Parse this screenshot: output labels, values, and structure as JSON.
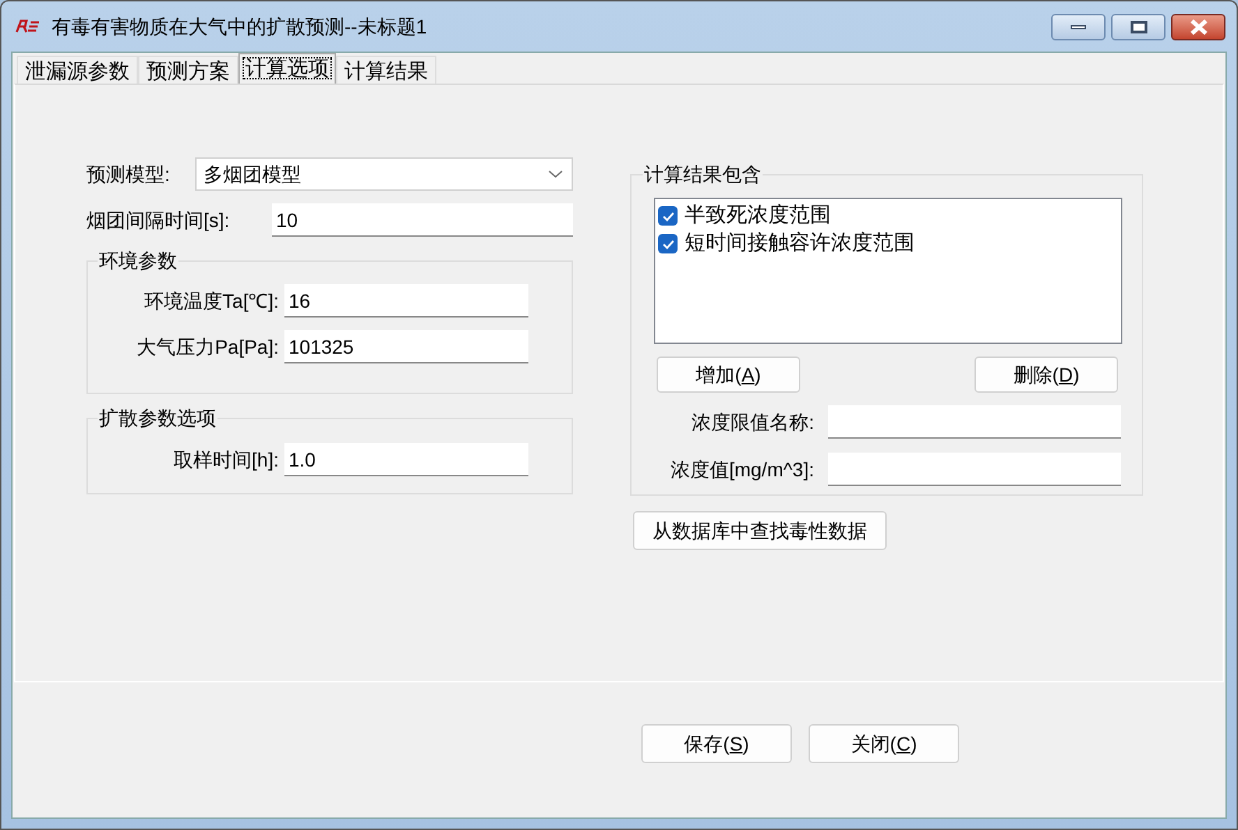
{
  "window": {
    "title": "有毒有害物质在大气中的扩散预测--未标题1"
  },
  "tabs": [
    {
      "label": "泄漏源参数",
      "selected": false
    },
    {
      "label": "预测方案",
      "selected": false
    },
    {
      "label": "计算选项",
      "selected": true
    },
    {
      "label": "计算结果",
      "selected": false
    }
  ],
  "model": {
    "label": "预测模型:",
    "value": "多烟团模型"
  },
  "puff_interval": {
    "label": "烟团间隔时间[s]:",
    "value": "10"
  },
  "environment": {
    "title": "环境参数",
    "fields": [
      {
        "label": "环境温度Ta[℃]:",
        "value": "16"
      },
      {
        "label": "大气压力Pa[Pa]:",
        "value": "101325"
      }
    ]
  },
  "diffusion": {
    "title": "扩散参数选项",
    "fields": [
      {
        "label": "取样时间[h]:",
        "value": "1.0"
      }
    ]
  },
  "results": {
    "title": "计算结果包含",
    "items": [
      {
        "label": "半致死浓度范围",
        "checked": true
      },
      {
        "label": "短时间接触容许浓度范围",
        "checked": true
      }
    ],
    "buttons": [
      {
        "before": "增加(",
        "key": "A",
        "after": ")"
      },
      {
        "before": "删除(",
        "key": "D",
        "after": ")"
      }
    ],
    "fields": [
      {
        "label": "浓度限值名称:"
      },
      {
        "label": "浓度值[mg/m^3]:"
      }
    ]
  },
  "lookup_button": {
    "label": "从数据库中查找毒性数据"
  },
  "footer_buttons": [
    {
      "before": "保存(",
      "key": "S",
      "after": ")"
    },
    {
      "before": "关闭(",
      "key": "C",
      "after": ")"
    }
  ]
}
